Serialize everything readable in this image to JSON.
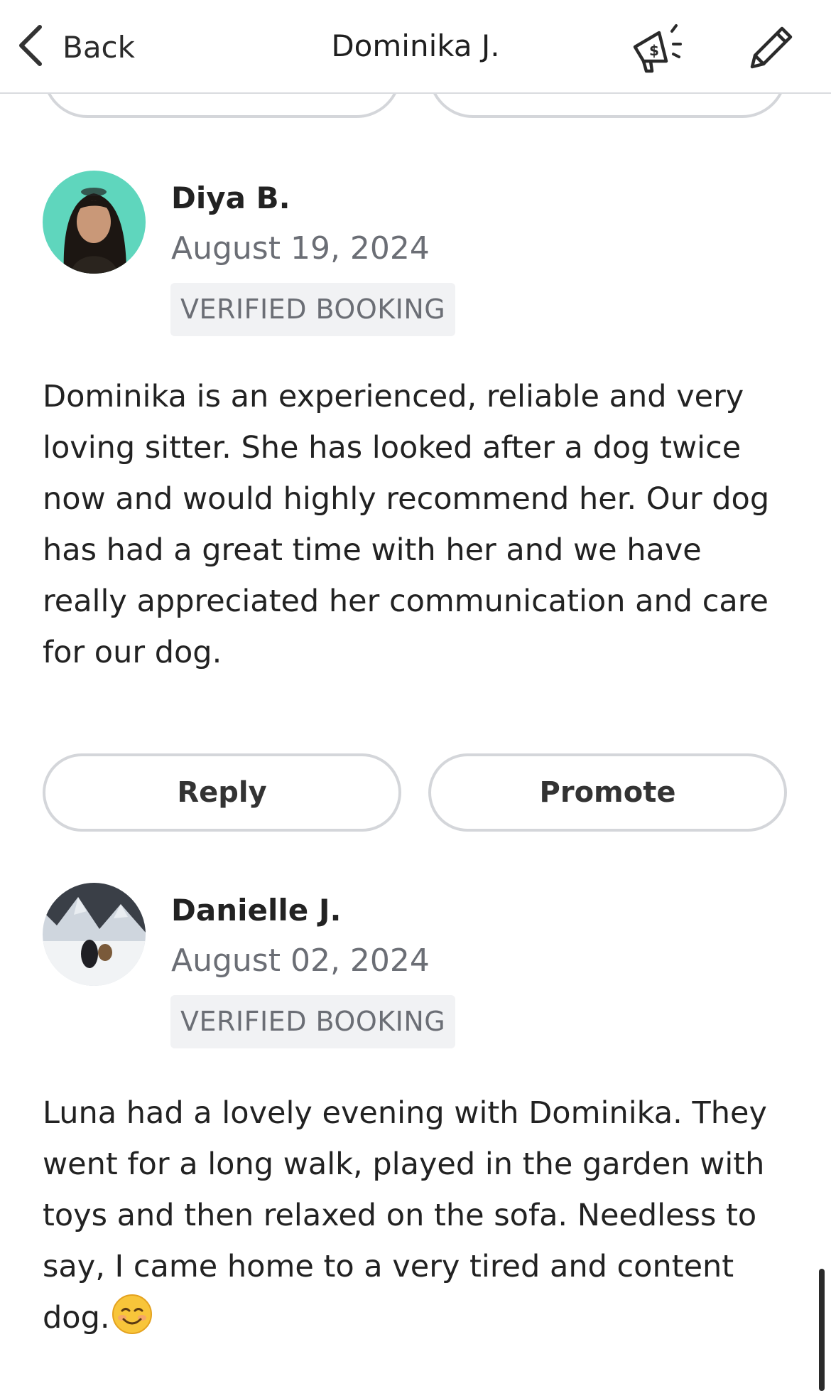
{
  "navbar": {
    "back_label": "Back",
    "title": "Dominika J.",
    "icons": [
      "chevron-left-icon",
      "megaphone-dollar-icon",
      "pencil-icon"
    ]
  },
  "reviews": [
    {
      "reviewer": "Diya B.",
      "date": "August 19, 2024",
      "badge": "VERIFIED BOOKING",
      "text": "Dominika is an experienced, reliable and very loving sitter. She has looked after a dog twice now and would highly recommend her. Our dog has had a great time with her and we have really appreciated her communication and care for our dog.",
      "actions": {
        "reply": "Reply",
        "promote": "Promote"
      }
    },
    {
      "reviewer": "Danielle J.",
      "date": "August 02, 2024",
      "badge": "VERIFIED BOOKING",
      "text": "Luna had a lovely evening with Dominika. They went for a long walk, played in the garden with toys and then relaxed on the sofa. Needless to say, I came home to a very tired and content dog.",
      "emoji": "smiling-face-emoji"
    }
  ],
  "colors": {
    "text": "#222222",
    "muted": "#6b6e75",
    "badge_bg": "#f1f2f4",
    "button_border": "#d4d6da"
  }
}
